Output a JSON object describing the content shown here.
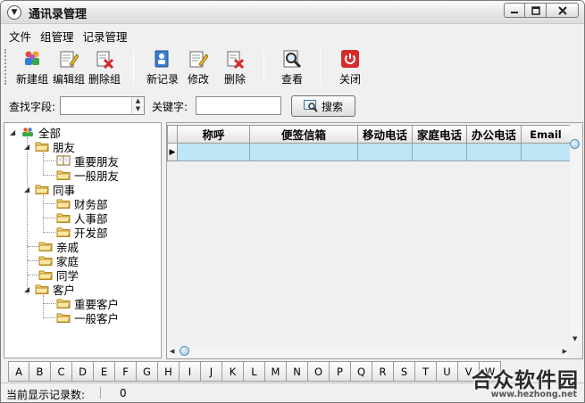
{
  "window": {
    "title": "通讯录管理",
    "menu_icon": "chevron-down-icon",
    "minimize": "minimize-icon",
    "maximize": "maximize-icon",
    "close": "close-icon"
  },
  "menubar": [
    {
      "label": "文件"
    },
    {
      "label": "组管理"
    },
    {
      "label": "记录管理"
    }
  ],
  "toolbar": {
    "new_group": "新建组",
    "edit_group": "编辑组",
    "delete_group": "删除组",
    "new_record": "新记录",
    "edit_record": "修改",
    "delete_record": "删除",
    "view": "查看",
    "close": "关闭"
  },
  "search": {
    "field_label": "查找字段:",
    "field_value": "",
    "keyword_label": "关键字:",
    "keyword_value": "",
    "button_label": "搜索"
  },
  "tree": {
    "root": "全部",
    "friends": "朋友",
    "friends_important": "重要朋友",
    "friends_normal": "一般朋友",
    "colleagues": "同事",
    "finance": "财务部",
    "hr": "人事部",
    "dev": "开发部",
    "relatives": "亲戚",
    "family": "家庭",
    "classmates": "同学",
    "clients": "客户",
    "clients_important": "重要客户",
    "clients_normal": "一般客户"
  },
  "grid": {
    "columns": [
      "称呼",
      "便签信箱",
      "移动电话",
      "家庭电话",
      "办公电话",
      "Email"
    ],
    "current_row_marker": "▶"
  },
  "alphabet": [
    "A",
    "B",
    "C",
    "D",
    "E",
    "F",
    "G",
    "H",
    "I",
    "J",
    "K",
    "L",
    "M",
    "N",
    "O",
    "P",
    "Q",
    "R",
    "S",
    "T",
    "U",
    "V",
    "W"
  ],
  "status": {
    "label": "当前显示记录数:",
    "count": "0"
  },
  "watermark": {
    "brand": "合众软件园",
    "url": "www.hezhong.net"
  },
  "colors": {
    "selected_row": "#bfe6f7",
    "folder": "#f3d37a",
    "close_red": "#d42b2b"
  }
}
